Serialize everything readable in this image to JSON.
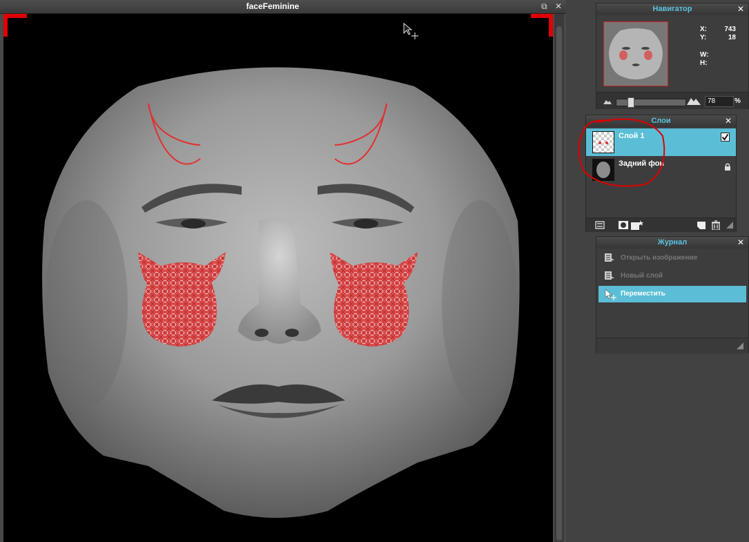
{
  "document": {
    "title": "faceFeminine"
  },
  "navigator": {
    "title": "Навигатор",
    "x_label": "X:",
    "x_value": "743",
    "y_label": "Y:",
    "y_value": "18",
    "w_label": "W:",
    "w_value": "",
    "h_label": "H:",
    "h_value": "",
    "zoom_value": "78",
    "zoom_unit": "%"
  },
  "layers": {
    "title": "Слои",
    "items": [
      {
        "name": "Слой 1",
        "selected": true,
        "visible_checked": true
      },
      {
        "name": "Задний фон",
        "selected": false,
        "locked": true
      }
    ]
  },
  "history": {
    "title": "Журнал",
    "items": [
      {
        "label": "Открыть изображение",
        "state": "dim"
      },
      {
        "label": "Новый слой",
        "state": "dim"
      },
      {
        "label": "Переместить",
        "state": "selected"
      }
    ]
  },
  "colors": {
    "accent": "#5bbed6",
    "annotation_red": "#e00000"
  }
}
